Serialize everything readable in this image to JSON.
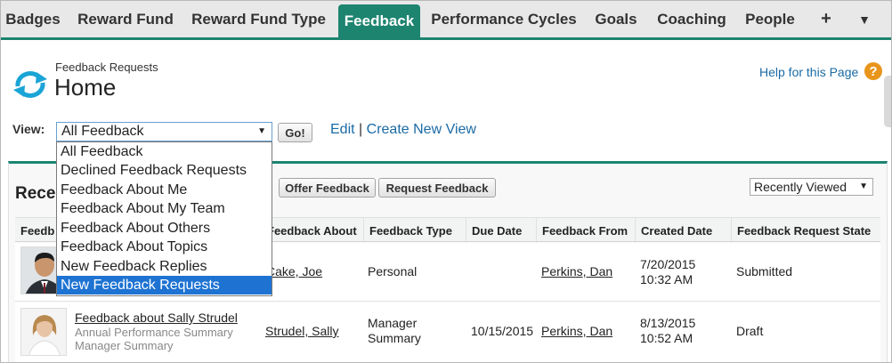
{
  "tabs": [
    "Badges",
    "Reward Fund",
    "Reward Fund Type",
    "Feedback",
    "Performance Cycles",
    "Goals",
    "Coaching",
    "People"
  ],
  "tabs_extra": {
    "add": "+",
    "more": "▼"
  },
  "header": {
    "subtitle": "Feedback Requests",
    "title": "Home",
    "help": "Help for this Page",
    "help_icon_glyph": "?"
  },
  "view": {
    "label": "View:",
    "selected": "All Feedback",
    "caret": "▼",
    "go": "Go!",
    "edit": "Edit",
    "separator": "|",
    "create": "Create New View",
    "options": [
      "All Feedback",
      "Declined Feedback Requests",
      "Feedback About Me",
      "Feedback About My Team",
      "Feedback About Others",
      "Feedback About Topics",
      "New Feedback Replies",
      "New Feedback Requests"
    ],
    "highlighted_index": 7
  },
  "recent": {
    "title": "Rece",
    "offer_button": "Offer Feedback",
    "request_button": "Request Feedback",
    "sort": "Recently Viewed",
    "sort_caret": "▼"
  },
  "table": {
    "headers": [
      "Feedb",
      "Feedback About",
      "Feedback Type",
      "Due Date",
      "Feedback From",
      "Created Date",
      "Feedback Request State"
    ],
    "rows": [
      {
        "title": "",
        "sub1": "",
        "sub2": "",
        "about": "Cake, Joe",
        "type1": "Personal",
        "type2": "",
        "due": "",
        "from": "Perkins, Dan",
        "created_date": "7/20/2015",
        "created_time": "10:32 AM",
        "state": "Submitted"
      },
      {
        "title": "Feedback about Sally Strudel",
        "sub1": "Annual Performance Summary",
        "sub2": "Manager Summary",
        "about": "Strudel, Sally",
        "type1": "Manager",
        "type2": "Summary",
        "due": "10/15/2015",
        "from": "Perkins, Dan",
        "created_date": "8/13/2015",
        "created_time": "10:52 AM",
        "state": "Draft"
      }
    ]
  },
  "colors": {
    "accent": "#1d8470",
    "link": "#1a6aa5",
    "selection": "#1e73d2",
    "help": "#e8951b"
  }
}
